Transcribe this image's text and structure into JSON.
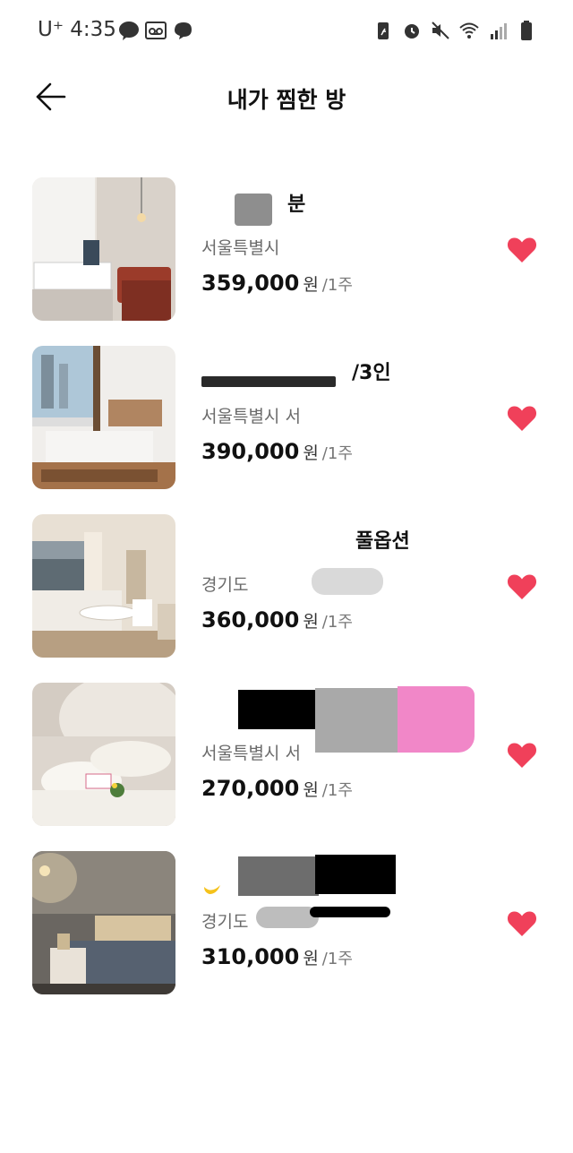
{
  "status_bar": {
    "carrier": "U⁺ 4:35"
  },
  "header": {
    "title": "내가 찜한 방"
  },
  "colors": {
    "heart": "#f0405a",
    "price": "#111111",
    "address": "#6b6b6b"
  },
  "items": [
    {
      "title": "분",
      "address": "서울특별시",
      "price": "359,000",
      "unit": "원",
      "period": "/1주"
    },
    {
      "title": "/3인",
      "address": "서울특별시 서",
      "price": "390,000",
      "unit": "원",
      "period": "/1주"
    },
    {
      "title": "풀옵션",
      "address": "경기도",
      "price": "360,000",
      "unit": "원",
      "period": "/1주"
    },
    {
      "title": "",
      "address": "서울특별시 서",
      "price": "270,000",
      "unit": "원",
      "period": "/1주"
    },
    {
      "title": "",
      "address": "경기도",
      "price": "310,000",
      "unit": "원",
      "period": "/1주"
    }
  ]
}
